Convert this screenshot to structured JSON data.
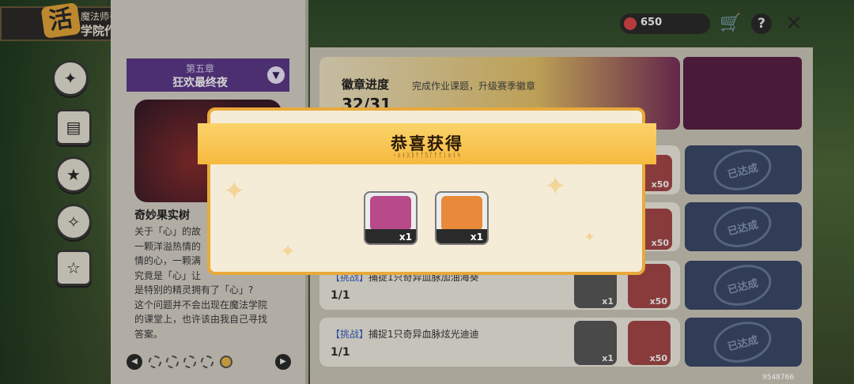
{
  "title_badge": {
    "logo": "活",
    "subtitle": "魔法师手册",
    "title": "学院作业"
  },
  "sidebar": {
    "items": [
      {
        "icon": "compass-icon"
      },
      {
        "icon": "card-icon"
      },
      {
        "icon": "star-badge-icon"
      },
      {
        "icon": "sparkle-icon"
      },
      {
        "icon": "star-card-icon"
      }
    ]
  },
  "chapter": {
    "number": "第五章",
    "title": "狂欢最终夜"
  },
  "story": {
    "title": "奇妙果实树",
    "lines": [
      "关于「心」的故",
      "一颗洋溢热情的",
      "情的心，一颗满",
      "究竟是「心」让",
      "是特别的精灵拥有了「心」?",
      "这个问题并不会出现在魔法学院",
      "的课堂上，也许该由我自己寻找",
      "答案。"
    ]
  },
  "badge": {
    "title": "徽章进度",
    "desc": "完成作业课题，升级赛季徽章",
    "count": "32/31"
  },
  "tasks": [
    {
      "tag": "【挑战】",
      "text": "捕捉1只奇异血脉加油海葵",
      "progress": "1/1",
      "rewards": [
        "x1",
        "x50"
      ],
      "status": "已达成"
    },
    {
      "tag": "【挑战】",
      "text": "捕捉1只奇异血脉炫光迪迪",
      "progress": "1/1",
      "rewards": [
        "x1",
        "x50"
      ],
      "status": "已达成"
    }
  ],
  "extra_status": [
    "已达成",
    "已达成"
  ],
  "extra_reward_qty": [
    "x50",
    "x50"
  ],
  "hud": {
    "currency": "650"
  },
  "modal": {
    "title": "恭喜获得",
    "subtitle": "ᚲᛟᚾᚷᚱᚨᛏᚢᛚᚨᛏᛁᛟᚾᛋ",
    "rewards": [
      {
        "name": "reward-card-pack",
        "qty": "x1",
        "color": "#b84a8a"
      },
      {
        "name": "reward-gift-box",
        "qty": "x1",
        "color": "#e98a3a"
      }
    ]
  },
  "uid": "9548766"
}
